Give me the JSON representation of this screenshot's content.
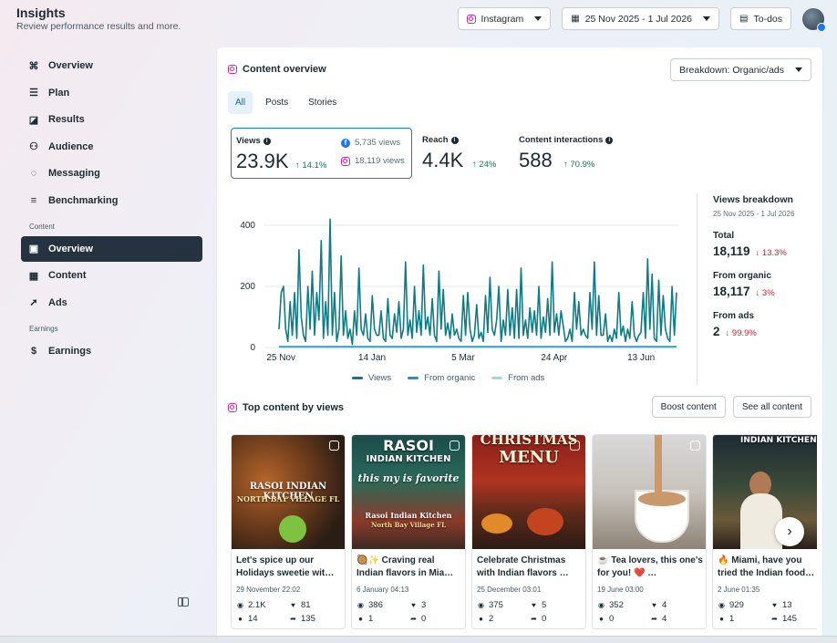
{
  "header": {
    "title": "Insights",
    "subtitle": "Review performance results and more."
  },
  "top_actions": {
    "platform": "Instagram",
    "date_range": "25 Nov 2025 - 1 Jul 2026",
    "todos": "To-dos"
  },
  "sidebar": {
    "items": [
      {
        "label": "Overview",
        "icon": "overview-icon"
      },
      {
        "label": "Plan",
        "icon": "plan-icon"
      },
      {
        "label": "Results",
        "icon": "results-icon"
      },
      {
        "label": "Audience",
        "icon": "audience-icon"
      },
      {
        "label": "Messaging",
        "icon": "messaging-icon"
      },
      {
        "label": "Benchmarking",
        "icon": "benchmarking-icon"
      }
    ],
    "content_section": "Content",
    "content_items": [
      {
        "label": "Overview",
        "active": true
      },
      {
        "label": "Content"
      },
      {
        "label": "Ads"
      }
    ],
    "earnings_section": "Earnings",
    "earnings_items": [
      {
        "label": "Earnings"
      }
    ]
  },
  "overview": {
    "title": "Content overview",
    "breakdown_button": "Breakdown: Organic/ads",
    "tabs": [
      "All",
      "Posts",
      "Stories"
    ],
    "metrics": {
      "views": {
        "label": "Views",
        "value": "23.9K",
        "change": "↑ 14.1%",
        "facebook": "5,735 views",
        "instagram": "18,119 views"
      },
      "reach": {
        "label": "Reach",
        "value": "4.4K",
        "change": "↑ 24%"
      },
      "interactions": {
        "label": "Content interactions",
        "value": "588",
        "change": "↑ 70.9%"
      }
    },
    "legend": {
      "views": "Views",
      "organic": "From organic",
      "ads": "From ads"
    }
  },
  "breakdown": {
    "title": "Views breakdown",
    "date": "25 Nov 2025 - 1 Jul 2026",
    "total_label": "Total",
    "total_value": "18,119",
    "total_change": "↓ 13.3%",
    "organic_label": "From organic",
    "organic_value": "18,117",
    "organic_change": "↓ 3%",
    "ads_label": "From ads",
    "ads_value": "2",
    "ads_change": "↓ 99.9%"
  },
  "top_content": {
    "title": "Top content by views",
    "boost_button": "Boost content",
    "see_all_button": "See all content",
    "posts": [
      {
        "caption": "Let's spice up our Holidays sweetie wit…",
        "date": "29 November 22:02",
        "views": "2.1K",
        "likes": "81",
        "comments": "14",
        "shares": "135",
        "thumb_text_1": "RASOI INDIAN KITCHEN",
        "thumb_text_2": "NORTH BAY VILLAGE FL"
      },
      {
        "caption": "🥘✨ Craving real Indian flavors in Mia…",
        "date": "6 January 04:13",
        "views": "386",
        "likes": "3",
        "comments": "1",
        "shares": "0",
        "thumb_text_1": "RASOI",
        "thumb_text_2": "INDIAN KITCHEN",
        "thumb_text_3": "this my is favorite",
        "thumb_text_4": "Rasoi Indian Kitchen",
        "thumb_text_5": "North Bay Village FL"
      },
      {
        "caption": "Celebrate Christmas with Indian flavors …",
        "date": "25 December 03:01",
        "views": "375",
        "likes": "5",
        "comments": "2",
        "shares": "0",
        "thumb_text_1": "CHRISTMAS",
        "thumb_text_2": "MENU"
      },
      {
        "caption": "☕ Tea lovers, this one's for you! ❤️ …",
        "date": "19 June 03:00",
        "views": "352",
        "likes": "4",
        "comments": "0",
        "shares": "4"
      },
      {
        "caption": "🔥 Miami, have you tried the Indian food…",
        "date": "2 June 01:35",
        "views": "929",
        "likes": "13",
        "comments": "1",
        "shares": "145",
        "thumb_text_1": "INDIAN KITCHEN"
      }
    ]
  },
  "chart_data": {
    "type": "line",
    "x_tick_labels": [
      "25 Nov",
      "14 Jan",
      "5 Mar",
      "24 Apr",
      "13 Jun"
    ],
    "y_ticks": [
      0,
      200,
      400
    ],
    "ylim": [
      0,
      430
    ],
    "series": [
      {
        "name": "Views",
        "color": "#0e7c86",
        "values": [
          60,
          180,
          200,
          60,
          20,
          150,
          40,
          180,
          30,
          320,
          100,
          40,
          20,
          200,
          60,
          250,
          40,
          180,
          90,
          350,
          30,
          150,
          40,
          420,
          40,
          180,
          20,
          60,
          300,
          40,
          120,
          30,
          60,
          10,
          120,
          40,
          260,
          60,
          40,
          110,
          30,
          20,
          170,
          60,
          40,
          40,
          120,
          30,
          20,
          160,
          40,
          30,
          110,
          50,
          150,
          30,
          60,
          280,
          40,
          90,
          30,
          200,
          50,
          120,
          40,
          270,
          60,
          100,
          40,
          160,
          40,
          20,
          250,
          60,
          190,
          40,
          80,
          30,
          110,
          40,
          60,
          30,
          20,
          170,
          40,
          180,
          60,
          20,
          40,
          140,
          30,
          50,
          20,
          170,
          50,
          230,
          60,
          40,
          90,
          200,
          20,
          90,
          40,
          190,
          40,
          130,
          30,
          190,
          30,
          260,
          40,
          90,
          30,
          130,
          50,
          120,
          40,
          200,
          30,
          100,
          50,
          160,
          40,
          280,
          50,
          110,
          40,
          120,
          70,
          20,
          30,
          60,
          20,
          180,
          60,
          150,
          40,
          60,
          40,
          30,
          180,
          60,
          280,
          40,
          170,
          40,
          40,
          110,
          20,
          40,
          20,
          60,
          30,
          180,
          40,
          70,
          20,
          60,
          30,
          150,
          40,
          20,
          40,
          50,
          180,
          30,
          290,
          60,
          240,
          30,
          20,
          220,
          40,
          170,
          60,
          30,
          20,
          200,
          40,
          180
        ]
      },
      {
        "name": "From organic",
        "color": "#1a97c4",
        "values": [
          3,
          3,
          3,
          3,
          3,
          3,
          3,
          3,
          3,
          3,
          3,
          3,
          3,
          3,
          3,
          3,
          3,
          3,
          3,
          3
        ]
      },
      {
        "name": "From ads",
        "color": "#9adbea",
        "values": [
          0,
          0,
          0,
          0,
          0,
          0,
          0,
          0,
          0,
          0,
          0,
          0,
          0,
          0,
          0,
          0,
          0,
          0,
          0,
          0
        ]
      }
    ]
  }
}
